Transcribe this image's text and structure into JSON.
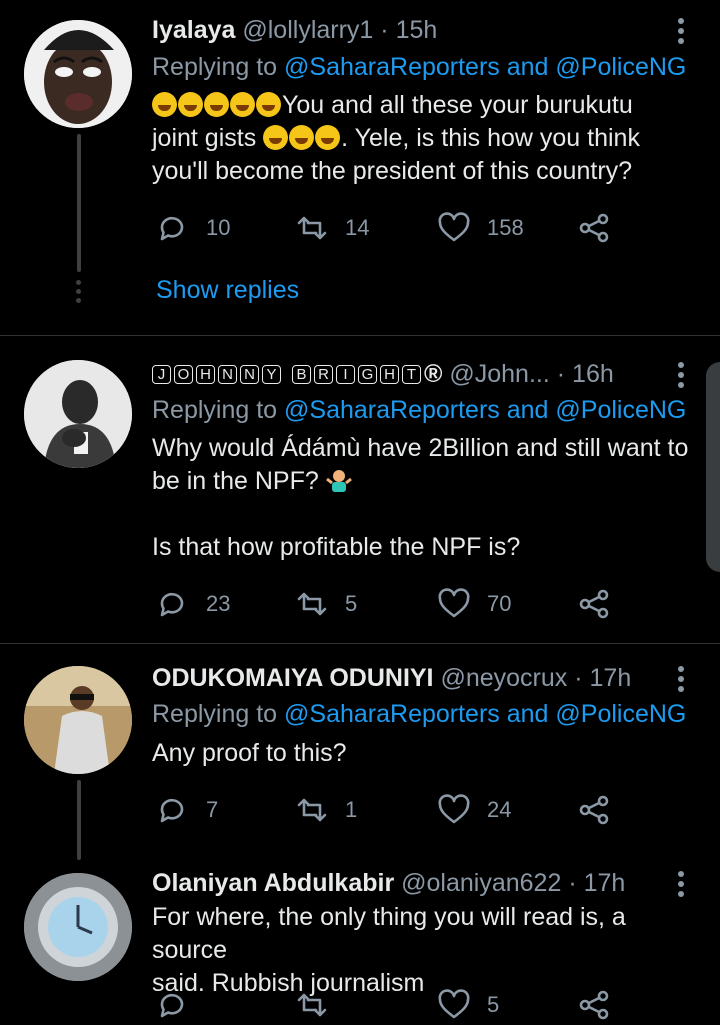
{
  "tweets": [
    {
      "name": "Iyalaya",
      "handle": "@lollylarry1",
      "time": "15h",
      "replying_prefix": "Replying to ",
      "replying_targets": "@SaharaReporters and @PoliceNG",
      "text_line1": "You and all these your burukutu",
      "text_line2a": "joint gists ",
      "text_line2b": ". Yele, is this how you think",
      "text_line3": "you'll become the president of this country?",
      "replies": "10",
      "retweets": "14",
      "likes": "158",
      "show_replies": "Show replies"
    },
    {
      "name_letters": [
        "J",
        "O",
        "H",
        "N",
        "N",
        "Y",
        "B",
        "R",
        "I",
        "G",
        "H",
        "T"
      ],
      "name_suffix": "®",
      "handle": "@John...",
      "time": "16h",
      "replying_prefix": "Replying to ",
      "replying_targets": "@SaharaReporters and @PoliceNG",
      "text_line1": "Why would Ádámù have 2Billion and still want to",
      "text_line2": "be in the NPF? ",
      "text_line3": "Is that how profitable the NPF is?",
      "replies": "23",
      "retweets": "5",
      "likes": "70"
    },
    {
      "name": "ODUKOMAIYA ODUNIYI",
      "handle": "@neyocrux",
      "time": "17h",
      "replying_prefix": "Replying to ",
      "replying_targets": "@SaharaReporters and @PoliceNG",
      "text_line1": "Any proof to this?",
      "replies": "7",
      "retweets": "1",
      "likes": "24"
    },
    {
      "name": "Olaniyan Abdulkabir",
      "handle": "@olaniyan622",
      "time": "17h",
      "text_line1": "For where, the only thing you will read is, a source",
      "text_line2": "said. Rubbish journalism",
      "replies": "",
      "retweets": "",
      "likes": "5"
    }
  ],
  "separator": "·",
  "colors": {
    "background": "#000000",
    "link": "#1d9bf0",
    "muted": "#8b98a5",
    "text": "#e7e9ea"
  }
}
